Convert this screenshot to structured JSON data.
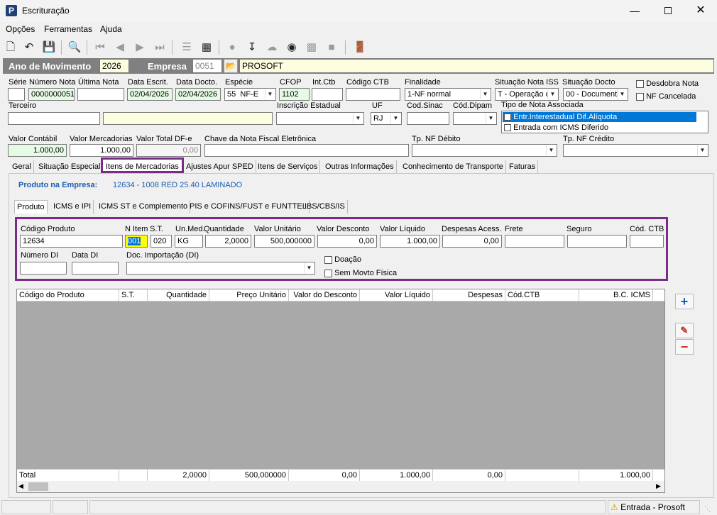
{
  "window": {
    "title": "Escrituração",
    "app_icon_letter": "P"
  },
  "menu": [
    "Opções",
    "Ferramentas",
    "Ajuda"
  ],
  "header": {
    "ano_label": "Ano de Movimento",
    "ano_value": "2026",
    "empresa_label": "Empresa",
    "empresa_code": "0051",
    "empresa_name": "PROSOFT"
  },
  "fields": {
    "serie": {
      "label": "Série",
      "value": ""
    },
    "numero_nota": {
      "label": "Número Nota",
      "value": "0000000051"
    },
    "ultima_nota": {
      "label": "Última Nota",
      "value": ""
    },
    "data_escrit": {
      "label": "Data Escrit.",
      "value": "02/04/2026"
    },
    "data_docto": {
      "label": "Data Docto.",
      "value": "02/04/2026"
    },
    "especie": {
      "label": "Espécie",
      "code": "55",
      "value": "NF-E"
    },
    "cfop": {
      "label": "CFOP",
      "value": "1102"
    },
    "int_ctb": {
      "label": "Int.Ctb",
      "value": ""
    },
    "codigo_ctb": {
      "label": "Código CTB",
      "value": ""
    },
    "finalidade": {
      "label": "Finalidade",
      "value": "1-NF normal"
    },
    "situacao_iss": {
      "label": "Situação Nota ISS",
      "value": "T - Operação c"
    },
    "situacao_docto": {
      "label": "Situação Docto",
      "value": "00 - Document"
    },
    "desdobra_nota": {
      "label": "Desdobra Nota"
    },
    "nf_cancelada": {
      "label": "NF Cancelada"
    },
    "terceiro": {
      "label": "Terceiro",
      "value": ""
    },
    "inscricao_estadual": {
      "label": "Inscrição Estadual",
      "value": ""
    },
    "uf": {
      "label": "UF",
      "value": "RJ"
    },
    "cod_sinac": {
      "label": "Cod.Sinac",
      "value": ""
    },
    "cod_dipam": {
      "label": "Cód.Dipam",
      "value": ""
    },
    "tipo_nota_associada": {
      "label": "Tipo de Nota Associada",
      "items": [
        "Entr.Interestadual Dif.Alíquota",
        "Entrada com ICMS Diferido"
      ]
    },
    "valor_contabil": {
      "label": "Valor Contábil",
      "value": "1.000,00"
    },
    "valor_mercadorias": {
      "label": "Valor Mercadorias",
      "value": "1.000,00"
    },
    "valor_total_dfe": {
      "label": "Valor Total DF-e",
      "value": "0,00"
    },
    "chave_nfe": {
      "label": "Chave da Nota Fiscal Eletrônica",
      "value": ""
    },
    "tp_nf_debito": {
      "label": "Tp. NF Débito",
      "value": ""
    },
    "tp_nf_credito": {
      "label": "Tp. NF Crédito",
      "value": ""
    }
  },
  "tabs": [
    "Geral",
    "Situação Especial",
    "Itens de Mercadorias",
    "Ajustes Apur SPED",
    "Itens de Serviços",
    "Outras Informações",
    "Conhecimento de Transporte",
    "Faturas"
  ],
  "produto_empresa": {
    "label": "Produto na Empresa:",
    "value": "12634 - 1008 RED 25.40 LAMINADO"
  },
  "subtabs": [
    "Produto",
    "ICMS e IPI",
    "ICMS ST e Complemento",
    "PIS e COFINS/FUST e FUNTTEL",
    "IBS/CBS/IS"
  ],
  "item": {
    "codigo_produto": {
      "label": "Código Produto",
      "value": "12634"
    },
    "n_item": {
      "label": "N Item",
      "value": "001"
    },
    "st": {
      "label": "S.T.",
      "value": "020"
    },
    "un_med": {
      "label": "Un.Med.",
      "value": "KG"
    },
    "quantidade": {
      "label": "Quantidade",
      "value": "2,0000"
    },
    "valor_unitario": {
      "label": "Valor Unitário",
      "value": "500,000000"
    },
    "valor_desconto": {
      "label": "Valor Desconto",
      "value": "0,00"
    },
    "valor_liquido": {
      "label": "Valor Líquido",
      "value": "1.000,00"
    },
    "despesas_acess": {
      "label": "Despesas Acess.",
      "value": "0,00"
    },
    "frete": {
      "label": "Frete",
      "value": ""
    },
    "seguro": {
      "label": "Seguro",
      "value": ""
    },
    "cod_ctb": {
      "label": "Cód. CTB",
      "value": ""
    },
    "numero_di": {
      "label": "Número DI",
      "value": ""
    },
    "data_di": {
      "label": "Data DI",
      "value": ""
    },
    "doc_importacao": {
      "label": "Doc. Importação (DI)",
      "value": ""
    },
    "doacao": {
      "label": "Doação"
    },
    "sem_movto": {
      "label": "Sem Movto Física"
    }
  },
  "grid": {
    "columns": [
      "Código do Produto",
      "S.T.",
      "Quantidade",
      "Preço Unitário",
      "Valor do Desconto",
      "Valor Líquido",
      "Despesas",
      "Cód.CTB",
      "B.C. ICMS"
    ],
    "totals": [
      "Total",
      "",
      "2,0000",
      "500,000000",
      "0,00",
      "1.000,00",
      "0,00",
      "",
      "1.000,00"
    ]
  },
  "status": {
    "text": "Entrada - Prosoft"
  },
  "colors": {
    "highlight": "#7b2c8a",
    "selection": "#0078d7",
    "blue_text": "#1a5fb4",
    "header_band": "#808080"
  }
}
